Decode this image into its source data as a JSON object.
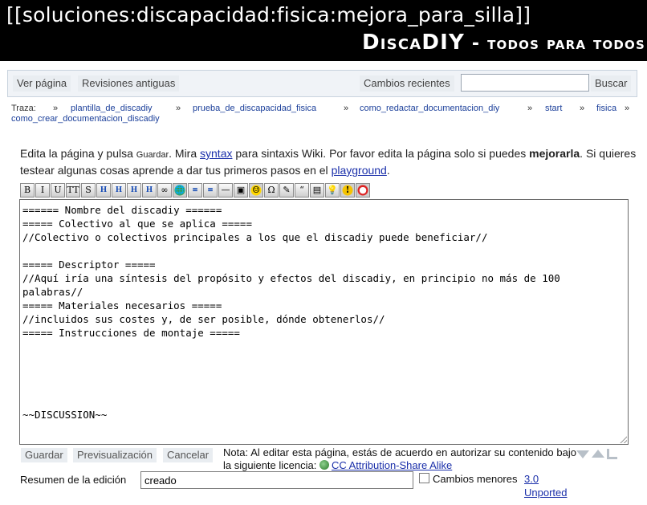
{
  "header": {
    "page_name": "[[soluciones:discapacidad:fisica:mejora_para_silla]]",
    "site_title_main": "DiscaDIY",
    "site_title_rest": " - todos para todos"
  },
  "nav": {
    "view_page": "Ver página",
    "old_revisions": "Revisiones antiguas",
    "recent_changes": "Cambios recientes",
    "search_button": "Buscar",
    "search_value": ""
  },
  "breadcrumbs": {
    "label": "Traza:",
    "separator": "»",
    "items": [
      "plantilla_de_discadiy",
      "prueba_de_discapacidad_fisica",
      "como_redactar_documentacion_diy",
      "start",
      "fisica",
      "como_crear_documentacion_discadiy"
    ]
  },
  "intro": {
    "p1": "Edita la página y pulsa ",
    "kw_save": "Guardar",
    "p2": ". Mira ",
    "syntax_link": "syntax",
    "p3": " para sintaxis Wiki. Por favor edita la página solo si puedes ",
    "bold": "mejorarla",
    "p4": ". Si quieres testear algunas cosas aprende a dar tus primeros pasos en el ",
    "playground_link": "playground",
    "p5": "."
  },
  "toolbar": {
    "buttons": [
      {
        "icon": "bold-icon",
        "glyph": "B"
      },
      {
        "icon": "italic-icon",
        "glyph": "I"
      },
      {
        "icon": "underline-icon",
        "glyph": "U"
      },
      {
        "icon": "monospace-icon",
        "glyph": "TT"
      },
      {
        "icon": "strikethrough-icon",
        "glyph": "S"
      },
      {
        "icon": "heading-same-level-icon",
        "glyph": "H"
      },
      {
        "icon": "heading-lower-level-icon",
        "glyph": "H"
      },
      {
        "icon": "heading-higher-level-icon",
        "glyph": "H"
      },
      {
        "icon": "heading-select-icon",
        "glyph": "H"
      },
      {
        "icon": "internal-link-icon",
        "glyph": "∞"
      },
      {
        "icon": "external-link-icon",
        "glyph": "🌐"
      },
      {
        "icon": "ordered-list-icon",
        "glyph": "≡"
      },
      {
        "icon": "unordered-list-icon",
        "glyph": "≡"
      },
      {
        "icon": "horizontal-rule-icon",
        "glyph": "—"
      },
      {
        "icon": "image-icon",
        "glyph": "▣"
      },
      {
        "icon": "smiley-icon",
        "glyph": "☺"
      },
      {
        "icon": "special-chars-icon",
        "glyph": "Ω"
      },
      {
        "icon": "signature-icon",
        "glyph": "✎"
      },
      {
        "icon": "quote-icon",
        "glyph": "“"
      },
      {
        "icon": "code-icon",
        "glyph": "▤"
      },
      {
        "icon": "tip-icon",
        "glyph": "💡"
      },
      {
        "icon": "warning-icon",
        "glyph": "!"
      },
      {
        "icon": "important-icon",
        "glyph": "●"
      }
    ]
  },
  "editor": {
    "content": "====== Nombre del discadiy ======\n===== Colectivo al que se aplica =====\n//Colectivo o colectivos principales a los que el discadiy puede beneficiar//\n\n===== Descriptor =====\n//Aquí iría una síntesis del propósito y efectos del discadiy, en principio no más de 100 palabras//\n===== Materiales necesarios =====\n//incluidos sus costes y, de ser posible, dónde obtenerlos//\n===== Instrucciones de montaje =====\n\n\n\n\n\n~~DISCUSSION~~"
  },
  "actions": {
    "save": "Guardar",
    "preview": "Previsualización",
    "cancel": "Cancelar"
  },
  "license": {
    "text": "Nota: Al editar esta página, estás de acuerdo en autorizar su contenido bajo la siguiente licencia: ",
    "link": "CC Attribution-Share Alike",
    "version": "3.0",
    "unported": "Unported"
  },
  "summary": {
    "label": "Resumen de la edición",
    "value": "creado",
    "minor_label": "Cambios menores"
  }
}
